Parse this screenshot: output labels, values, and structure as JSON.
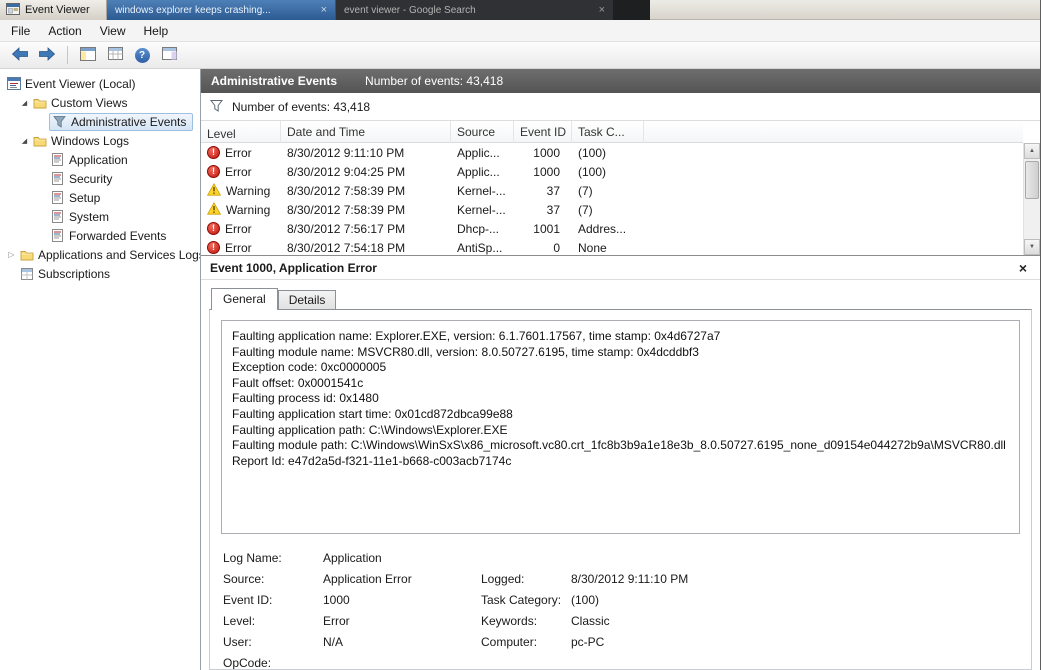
{
  "icons": {
    "close": "×",
    "scroll_up": "▲",
    "scroll_down": "▼",
    "tree_expanded": "◢",
    "tree_collapsed": "▷",
    "error_mark": "!",
    "help_mark": "?"
  },
  "colors": {
    "error_red": "#c4170e",
    "warning_yellow": "#ffd42a",
    "header_gray": "#5a5a5a",
    "selection_blue": "#d4e4f5"
  },
  "titlebar": {
    "title": "Event Viewer",
    "browser_tabs": [
      {
        "label": "windows explorer keeps crashing..."
      },
      {
        "label": "event viewer - Google Search"
      }
    ]
  },
  "menubar": {
    "items": [
      "File",
      "Action",
      "View",
      "Help"
    ]
  },
  "tree": {
    "root": "Event Viewer (Local)",
    "items": [
      {
        "label": "Custom Views"
      },
      {
        "label": "Administrative Events"
      },
      {
        "label": "Windows Logs"
      },
      {
        "label": "Application"
      },
      {
        "label": "Security"
      },
      {
        "label": "Setup"
      },
      {
        "label": "System"
      },
      {
        "label": "Forwarded Events"
      },
      {
        "label": "Applications and Services Logs"
      },
      {
        "label": "Subscriptions"
      }
    ]
  },
  "list": {
    "header_title": "Administrative Events",
    "header_count": "Number of events: 43,418",
    "filter_text": "Number of events: 43,418",
    "columns": [
      "Level",
      "Date and Time",
      "Source",
      "Event ID",
      "Task C..."
    ],
    "rows": [
      {
        "level": "Error",
        "datetime": "8/30/2012 9:11:10 PM",
        "source": "Applic...",
        "event_id": "1000",
        "task": "(100)"
      },
      {
        "level": "Error",
        "datetime": "8/30/2012 9:04:25 PM",
        "source": "Applic...",
        "event_id": "1000",
        "task": "(100)"
      },
      {
        "level": "Warning",
        "datetime": "8/30/2012 7:58:39 PM",
        "source": "Kernel-...",
        "event_id": "37",
        "task": "(7)"
      },
      {
        "level": "Warning",
        "datetime": "8/30/2012 7:58:39 PM",
        "source": "Kernel-...",
        "event_id": "37",
        "task": "(7)"
      },
      {
        "level": "Error",
        "datetime": "8/30/2012 7:56:17 PM",
        "source": "Dhcp-...",
        "event_id": "1001",
        "task": "Addres..."
      },
      {
        "level": "Error",
        "datetime": "8/30/2012 7:54:18 PM",
        "source": "AntiSp...",
        "event_id": "0",
        "task": "None"
      }
    ]
  },
  "detail": {
    "title": "Event 1000, Application Error",
    "tabs": [
      {
        "label": "General"
      },
      {
        "label": "Details"
      }
    ],
    "general_text": [
      "Faulting application name: Explorer.EXE, version: 6.1.7601.17567, time stamp: 0x4d6727a7",
      "Faulting module name: MSVCR80.dll, version: 8.0.50727.6195, time stamp: 0x4dcddbf3",
      "Exception code: 0xc0000005",
      "Fault offset: 0x0001541c",
      "Faulting process id: 0x1480",
      "Faulting application start time: 0x01cd872dbca99e88",
      "Faulting application path: C:\\Windows\\Explorer.EXE",
      "Faulting module path: C:\\Windows\\WinSxS\\x86_microsoft.vc80.crt_1fc8b3b9a1e18e3b_8.0.50727.6195_none_d09154e044272b9a\\MSVCR80.dll",
      "Report Id: e47d2a5d-f321-11e1-b668-c003acb7174c"
    ],
    "fields": [
      {
        "label": "Log Name:",
        "value": "Application",
        "label2": "",
        "value2": ""
      },
      {
        "label": "Source:",
        "value": "Application Error",
        "label2": "Logged:",
        "value2": "8/30/2012 9:11:10 PM"
      },
      {
        "label": "Event ID:",
        "value": "1000",
        "label2": "Task Category:",
        "value2": "(100)"
      },
      {
        "label": "Level:",
        "value": "Error",
        "label2": "Keywords:",
        "value2": "Classic"
      },
      {
        "label": "User:",
        "value": "N/A",
        "label2": "Computer:",
        "value2": "pc-PC"
      },
      {
        "label": "OpCode:",
        "value": "",
        "label2": "",
        "value2": ""
      }
    ]
  }
}
